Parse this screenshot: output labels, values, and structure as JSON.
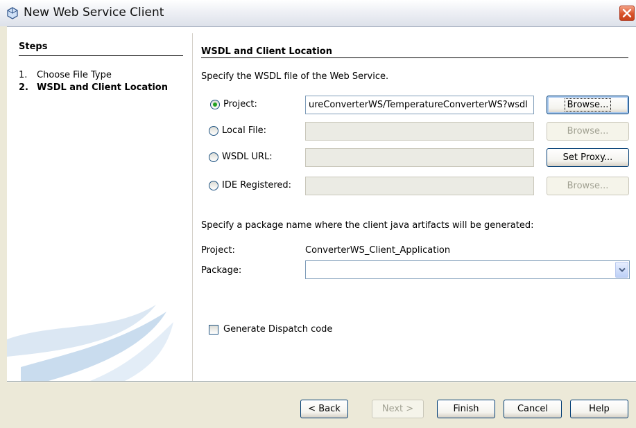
{
  "window": {
    "title": "New Web Service Client",
    "close_icon": "close-icon",
    "app_icon": "web-service-icon"
  },
  "steps": {
    "title": "Steps",
    "items": [
      {
        "num": "1.",
        "label": "Choose File Type"
      },
      {
        "num": "2.",
        "label": "WSDL and Client Location"
      }
    ]
  },
  "main": {
    "section_title": "WSDL and Client Location",
    "wsdl_instruction": "Specify the WSDL file of the Web Service.",
    "options": [
      {
        "label": "Project:",
        "value": "ureConverterWS/TemperatureConverterWS?wsdl",
        "button": "Browse...",
        "selected": true
      },
      {
        "label": "Local File:",
        "value": "",
        "button": "Browse...",
        "selected": false
      },
      {
        "label": "WSDL URL:",
        "value": "",
        "button": "Set Proxy...",
        "selected": false
      },
      {
        "label": "IDE Registered:",
        "value": "",
        "button": "Browse...",
        "selected": false
      }
    ],
    "package_instruction": "Specify a package name where the client java artifacts will be generated:",
    "project_label": "Project:",
    "project_value": "ConverterWS_Client_Application",
    "package_label": "Package:",
    "package_value": "",
    "dispatch_label": "Generate Dispatch code",
    "dispatch_checked": false
  },
  "footer": {
    "back": "< Back",
    "next": "Next >",
    "finish": "Finish",
    "cancel": "Cancel",
    "help": "Help"
  },
  "colors": {
    "titlebar": "#dde1ea",
    "footer": "#ece9d8",
    "button_border": "#003c74",
    "close_button": "#d9532a",
    "radio_dot": "#21a121"
  }
}
